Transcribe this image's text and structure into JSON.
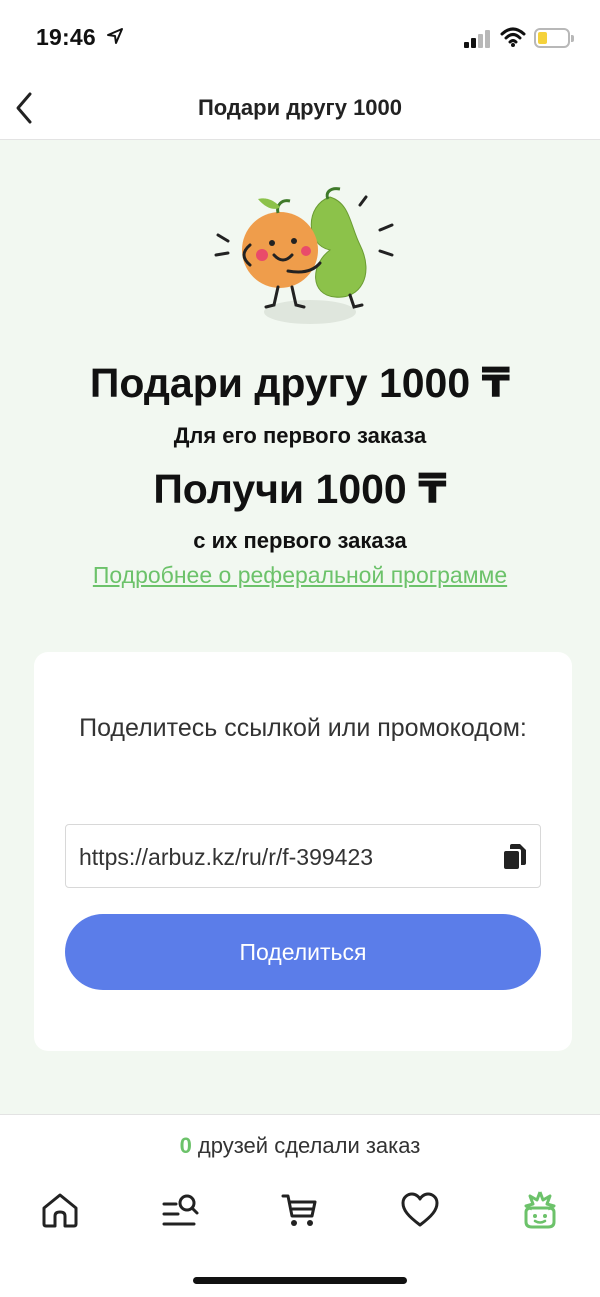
{
  "status_bar": {
    "time": "19:46"
  },
  "header": {
    "title": "Подари другу 1000"
  },
  "hero": {
    "title": "Подари другу 1000 ₸",
    "subtitle_1": "Для его первого заказа",
    "title_2": "Получи 1000 ₸",
    "subtitle_2": "с их первого заказа",
    "more_link": "Подробнее о реферальной программе"
  },
  "share": {
    "prompt": "Поделитесь ссылкой или промокодом:",
    "link_value": "https://arbuz.kz/ru/r/f-399423",
    "button_label": "Поделиться"
  },
  "friends": {
    "count": "0",
    "text": "друзей сделали заказ"
  },
  "tabs": [
    {
      "name": "home-icon",
      "active": false
    },
    {
      "name": "catalog-search-icon",
      "active": false
    },
    {
      "name": "cart-icon",
      "active": false
    },
    {
      "name": "heart-icon",
      "active": false
    },
    {
      "name": "profile-mascot-icon",
      "active": true
    }
  ],
  "colors": {
    "accent_green": "#6cc26a",
    "button_blue": "#5b7de9",
    "background": "#f2f8f1"
  }
}
